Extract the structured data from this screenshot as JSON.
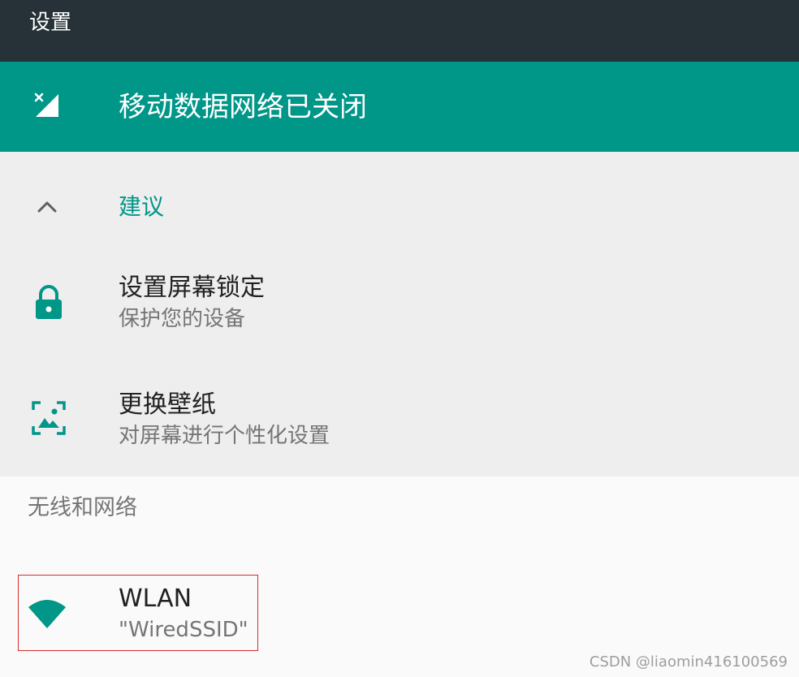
{
  "app_bar": {
    "title": "设置"
  },
  "banner": {
    "text": "移动数据网络已关闭",
    "icon": "signal-off-icon"
  },
  "suggestions": {
    "header": "建议",
    "items": [
      {
        "title": "设置屏幕锁定",
        "subtitle": "保护您的设备",
        "icon": "lock-icon"
      },
      {
        "title": "更换壁纸",
        "subtitle": "对屏幕进行个性化设置",
        "icon": "wallpaper-icon"
      }
    ]
  },
  "sections": [
    {
      "header": "无线和网络",
      "items": [
        {
          "title": "WLAN",
          "subtitle": "\"WiredSSID\"",
          "icon": "wifi-icon"
        }
      ]
    }
  ],
  "watermark": "CSDN @liaomin416100569",
  "colors": {
    "app_bar": "#263238",
    "accent": "#009688",
    "suggestions_bg": "#eeeeee",
    "page_bg": "#fafafa",
    "highlight_border": "#d32f2f"
  }
}
